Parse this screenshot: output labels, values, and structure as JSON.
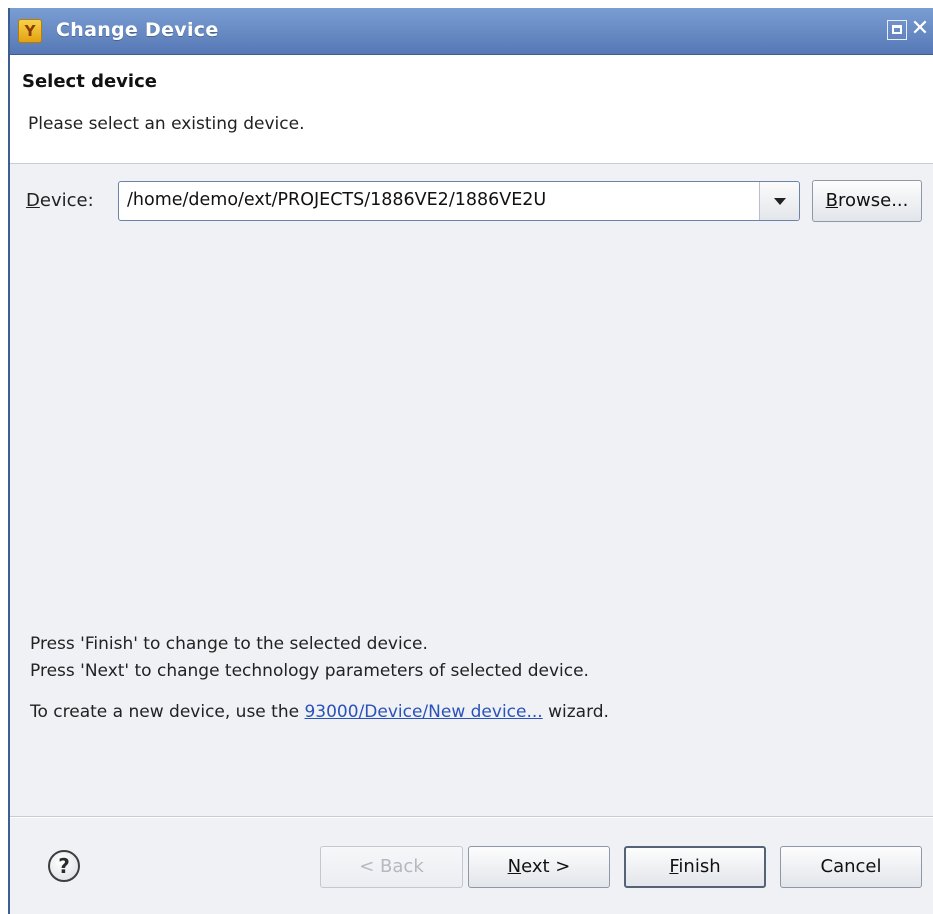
{
  "window": {
    "title": "Change Device",
    "app_icon_glyph": "Y",
    "maximize_icon": "maximize-icon",
    "close_glyph": "✕"
  },
  "header": {
    "title": "Select device",
    "description": "Please select an existing device."
  },
  "device": {
    "label_mnemonic": "D",
    "label_rest": "evice:",
    "value": "/home/demo/ext/PROJECTS/1886VE2/1886VE2U",
    "browse_mnemonic": "B",
    "browse_rest": "rowse..."
  },
  "info": {
    "line1": "Press 'Finish' to change to the selected device.",
    "line2": "Press 'Next' to change technology parameters of selected device.",
    "line3_prefix": "To create a new device, use the ",
    "line3_link": "93000/Device/New device...",
    "line3_suffix": " wizard."
  },
  "buttons": {
    "help_glyph": "?",
    "back_label": "< Back",
    "next_mnemonic": "N",
    "next_rest": "ext >",
    "finish_mnemonic": "F",
    "finish_rest": "inish",
    "cancel_label": "Cancel"
  },
  "colors": {
    "titlebar": "#5679b6",
    "link": "#2a52b9",
    "dialog_bg": "#eff1f5"
  }
}
